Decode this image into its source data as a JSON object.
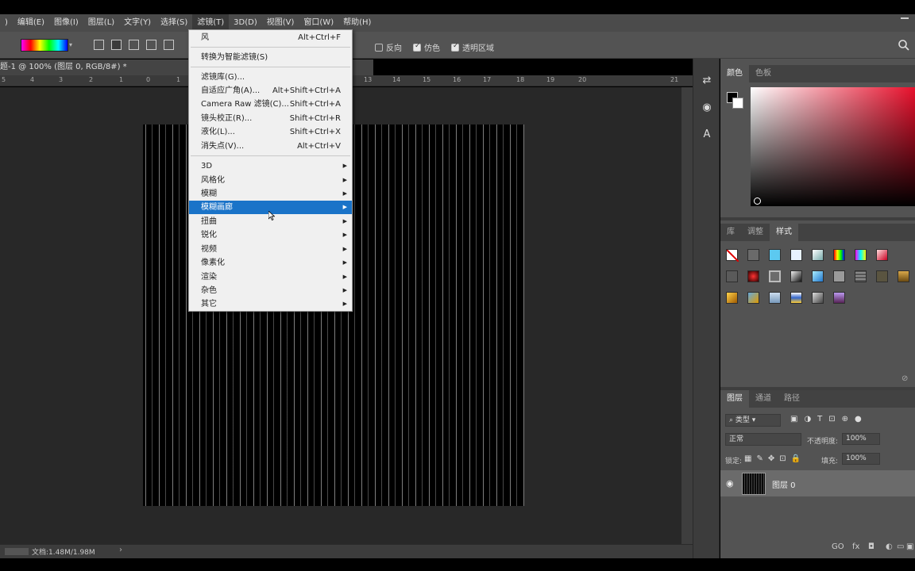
{
  "menubar": {
    "items": [
      "编辑(E)",
      "图像(I)",
      "图层(L)",
      "文字(Y)",
      "选择(S)",
      "滤镜(T)",
      "3D(D)",
      "视图(V)",
      "窗口(W)",
      "帮助(H)"
    ],
    "active": "滤镜(T)"
  },
  "options": {
    "reverse": "反向",
    "dither": "仿色",
    "transparency": "透明区域"
  },
  "doc": {
    "tab": "题-1 @ 100% (图层 0, RGB/8#) *",
    "ruler": [
      "5",
      "4",
      "3",
      "2",
      "1",
      "0",
      "1",
      "13",
      "14",
      "15",
      "16",
      "17",
      "18",
      "19",
      "20",
      "21"
    ],
    "status": "文档:1.48M/1.98M"
  },
  "filter_menu": {
    "items": [
      {
        "label": "风",
        "shortcut": "Alt+Ctrl+F"
      },
      {
        "label": "转换为智能滤镜(S)",
        "shortcut": ""
      },
      {
        "label": "滤镜库(G)...",
        "shortcut": ""
      },
      {
        "label": "自适应广角(A)...",
        "shortcut": "Alt+Shift+Ctrl+A"
      },
      {
        "label": "Camera Raw 滤镜(C)...",
        "shortcut": "Shift+Ctrl+A"
      },
      {
        "label": "镜头校正(R)...",
        "shortcut": "Shift+Ctrl+R"
      },
      {
        "label": "液化(L)...",
        "shortcut": "Shift+Ctrl+X"
      },
      {
        "label": "消失点(V)...",
        "shortcut": "Alt+Ctrl+V"
      },
      {
        "label": "3D",
        "shortcut": ""
      },
      {
        "label": "风格化",
        "shortcut": ""
      },
      {
        "label": "模糊",
        "shortcut": ""
      },
      {
        "label": "模糊画廊",
        "shortcut": ""
      },
      {
        "label": "扭曲",
        "shortcut": ""
      },
      {
        "label": "锐化",
        "shortcut": ""
      },
      {
        "label": "视频",
        "shortcut": ""
      },
      {
        "label": "像素化",
        "shortcut": ""
      },
      {
        "label": "渲染",
        "shortcut": ""
      },
      {
        "label": "杂色",
        "shortcut": ""
      },
      {
        "label": "其它",
        "shortcut": ""
      }
    ],
    "highlighted": "模糊画廊"
  },
  "color_panel": {
    "tabs": [
      "颜色",
      "色板"
    ]
  },
  "styles_panel": {
    "tabs": [
      "库",
      "调整",
      "样式"
    ]
  },
  "layers_panel": {
    "tabs": [
      "图层",
      "通道",
      "路径"
    ],
    "filter": "类型",
    "blend_mode": "正常",
    "opacity_label": "不透明度:",
    "opacity": "100%",
    "lock_label": "锁定:",
    "fill_label": "填充:",
    "fill": "100%",
    "layers": [
      {
        "name": "图层 0"
      }
    ],
    "footer": [
      "GO",
      "fx",
      "◘",
      "◐",
      "▭",
      "▣"
    ]
  },
  "colors": {
    "highlight": "#1a73c8",
    "menu_bg": "#f0f0f0",
    "panel": "#535353"
  }
}
